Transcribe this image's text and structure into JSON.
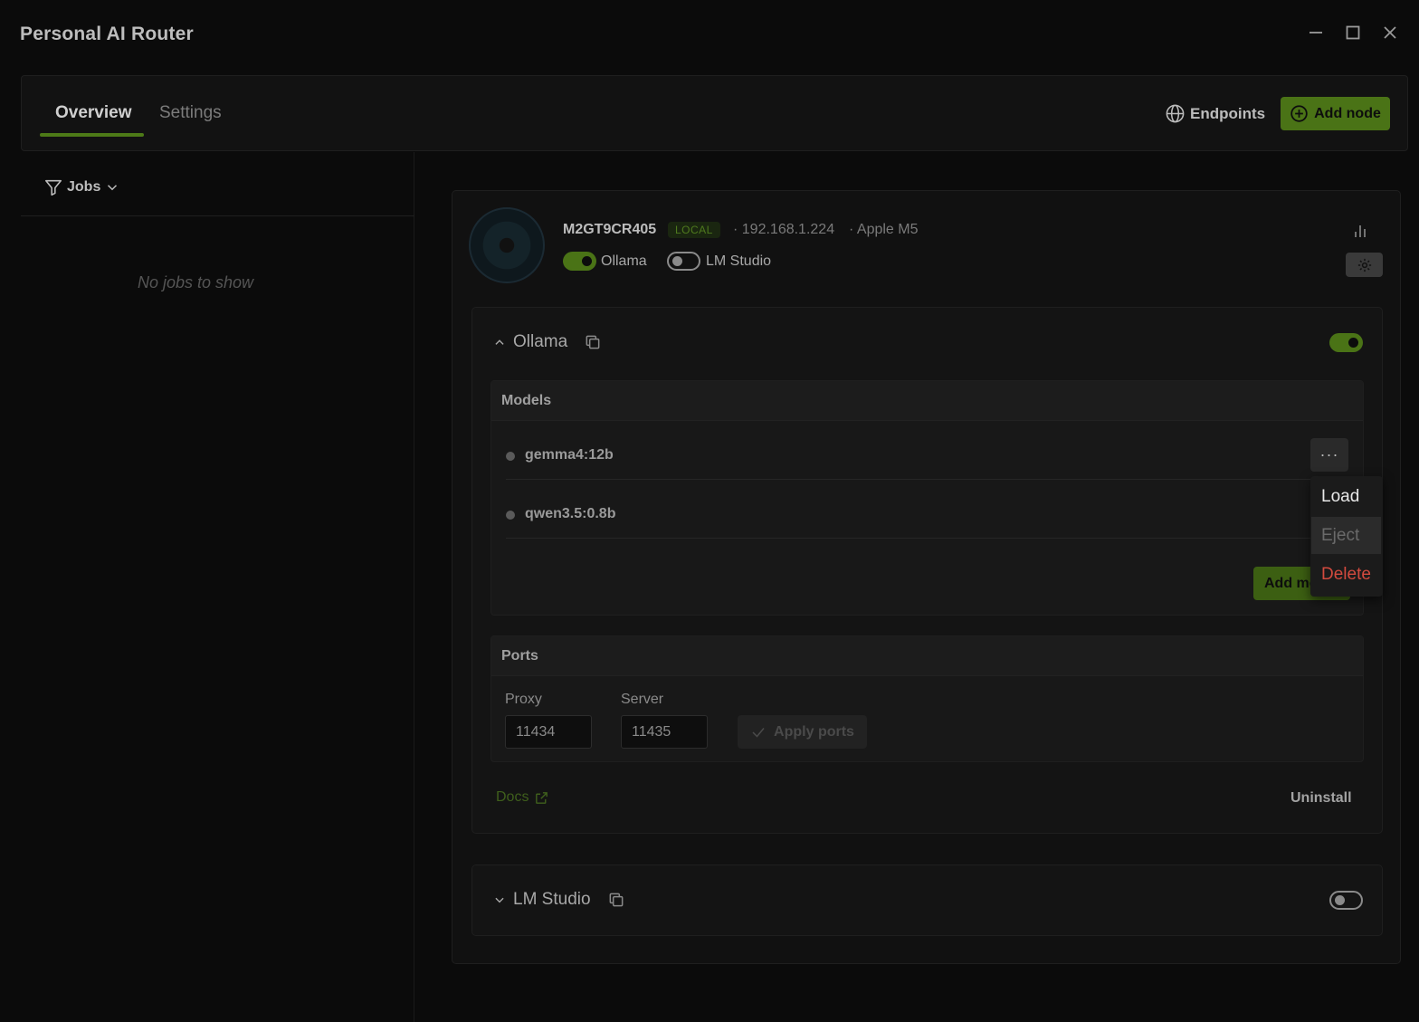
{
  "window": {
    "title": "Personal AI Router"
  },
  "tabs": {
    "overview": "Overview",
    "settings": "Settings"
  },
  "toolbar": {
    "endpoints_label": "Endpoints",
    "add_node_label": "Add node"
  },
  "sidebar": {
    "filter_label": "Jobs",
    "empty_text": "No jobs to show"
  },
  "node": {
    "name": "M2GT9CR405",
    "badge": "LOCAL",
    "ip": "· 192.168.1.224",
    "chip": "· Apple M5",
    "services": [
      {
        "label": "Ollama",
        "enabled": true
      },
      {
        "label": "LM Studio",
        "enabled": false
      }
    ]
  },
  "ollama_panel": {
    "title": "Ollama",
    "enabled": true,
    "models_header": "Models",
    "models": [
      {
        "name": "gemma4:12b"
      },
      {
        "name": "qwen3.5:0.8b"
      }
    ],
    "more_button": "···",
    "add_model_label": "Add model",
    "ports_header": "Ports",
    "proxy_label": "Proxy",
    "proxy_value": "11434",
    "server_label": "Server",
    "server_value": "11435",
    "apply_label": "Apply ports",
    "docs_label": "Docs",
    "uninstall_label": "Uninstall"
  },
  "lmstudio_panel": {
    "title": "LM Studio",
    "enabled": false
  },
  "context_menu": {
    "load": "Load",
    "eject": "Eject",
    "delete": "Delete"
  },
  "colors": {
    "accent": "#4a7316",
    "danger": "#d24a3e",
    "background": "#0b0b0b"
  }
}
